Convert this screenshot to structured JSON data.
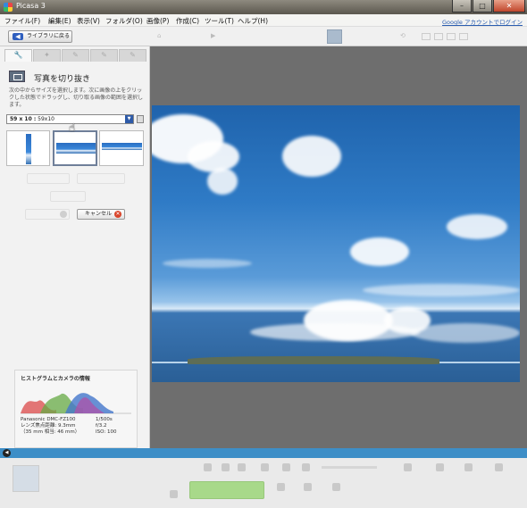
{
  "window": {
    "title": "Picasa 3",
    "close": "✕",
    "minimize": "–",
    "maximize": "□"
  },
  "menu": {
    "items": [
      "ファイル(F)",
      "編集(E)",
      "表示(V)",
      "フォルダ(O)",
      "画像(P)",
      "作成(C)",
      "ツール(T)",
      "ヘルプ(H)"
    ],
    "google_account": "Google アカウントでログイン"
  },
  "toolbar": {
    "back_label": "ライブラリに戻る"
  },
  "edit_panel": {
    "tabs": [
      "🔧",
      "✦",
      "✎",
      "✎",
      "✎"
    ],
    "crop_title": "写真を切り抜き",
    "help_text": "次の中からサイズを選択します。次に画像の上をクリックした状態でドラッグし、切り取る画像の範囲を選択します。",
    "size_selected_bold": "59 x 10 :",
    "size_selected_rest": "59x10",
    "buttons": {
      "cancel": "キャンセル"
    }
  },
  "histogram": {
    "title": "ヒストグラムとカメラの情報",
    "camera": "Panasonic DMC-FZ100",
    "lens_focal": "レンズ焦点距離: 9.3mm",
    "equiv_35mm": "（35 mm 相当: 46 mm）",
    "shutter": "1/500s",
    "aperture": "f/3.2",
    "iso": "ISO: 100"
  },
  "colors": {
    "accent": "#2d5aa8",
    "status_bar": "#3d8ec7",
    "cancel_icon": "#d9452b",
    "share_button": "#a8d98a"
  }
}
